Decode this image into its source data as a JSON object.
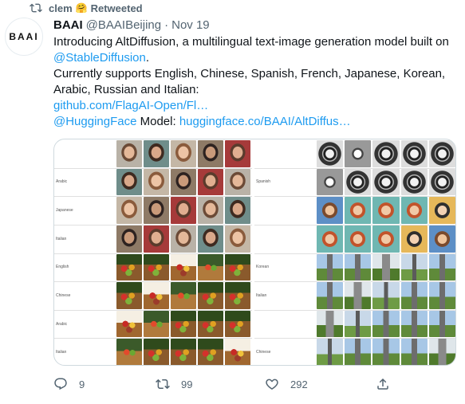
{
  "retweet": {
    "user": "clem",
    "emoji": "🤗",
    "label": "Retweeted"
  },
  "author": {
    "avatar_text": "BAAI",
    "name": "BAAI",
    "handle": "@BAAIBeijing",
    "separator": "·",
    "date": "Nov 19"
  },
  "tweet": {
    "line1": "Introducing AltDiffusion, a multilingual text-image generation model built on",
    "mention_stable": "@StableDiffusion",
    "line1_end": ".",
    "line2": "Currently supports English, Chinese, Spanish, French, Japanese, Korean,",
    "line3": "Arabic, Russian and Italian:",
    "github_link": "github.com/FlagAI-Open/Fl…",
    "mention_hf": "@HuggingFace",
    "model_label": " Model: ",
    "hf_link": "huggingface.co/BAAI/AltDiffus…"
  },
  "media": {
    "left_rows": [
      {
        "lang": "",
        "style": "face"
      },
      {
        "lang": "Arabic",
        "style": "face"
      },
      {
        "lang": "Japanese",
        "style": "face"
      },
      {
        "lang": "Italian",
        "style": "face"
      },
      {
        "lang": "English",
        "style": "fruit"
      },
      {
        "lang": "Chinese",
        "style": "fruit"
      },
      {
        "lang": "Arabic",
        "style": "fruit"
      },
      {
        "lang": "Italian",
        "style": "fruit"
      }
    ],
    "right_rows": [
      {
        "lang": "",
        "style": "sketch"
      },
      {
        "lang": "Spanish",
        "style": "sketch"
      },
      {
        "lang": "",
        "style": "cartoon"
      },
      {
        "lang": "",
        "style": "cartoon"
      },
      {
        "lang": "Korean",
        "style": "tower"
      },
      {
        "lang": "Italian",
        "style": "tower"
      },
      {
        "lang": "",
        "style": "tower"
      },
      {
        "lang": "Chinese",
        "style": "tower"
      }
    ]
  },
  "actions": {
    "replies": "9",
    "retweets": "99",
    "likes": "292"
  },
  "colors": {
    "link": "#1d9bf0",
    "secondary": "#536471"
  }
}
